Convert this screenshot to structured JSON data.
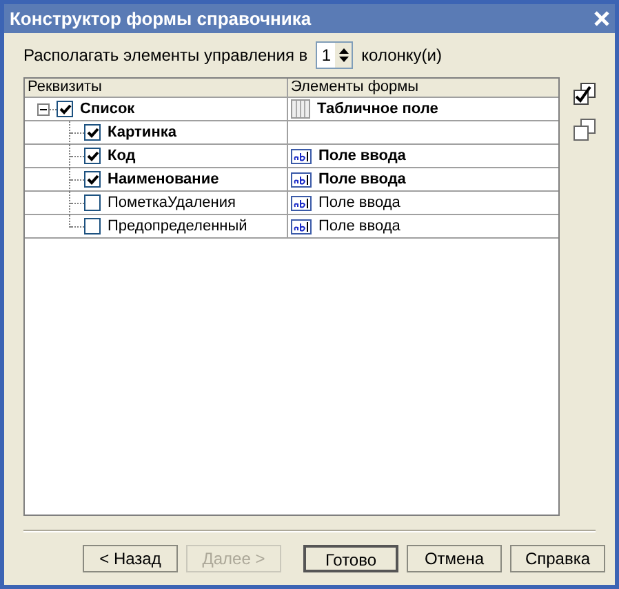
{
  "window": {
    "title": "Конструктор формы справочника"
  },
  "columns_setting": {
    "label": "Располагать элементы управления в",
    "value": "1",
    "suffix": "колонку(и)"
  },
  "table": {
    "columns": [
      "Реквизиты",
      "Элементы формы"
    ],
    "rows": [
      {
        "name": "Список",
        "checked": true,
        "expanded": true,
        "element": {
          "kind": "table",
          "label": "Табличное поле"
        },
        "children": [
          {
            "name": "Картинка",
            "checked": true
          },
          {
            "name": "Код",
            "checked": true,
            "element": {
              "kind": "input",
              "label": "Поле ввода"
            }
          },
          {
            "name": "Наименование",
            "checked": true,
            "element": {
              "kind": "input",
              "label": "Поле ввода"
            }
          },
          {
            "name": "ПометкаУдаления",
            "checked": false,
            "element": {
              "kind": "input",
              "label": "Поле ввода"
            }
          },
          {
            "name": "Предопределенный",
            "checked": false,
            "element": {
              "kind": "input",
              "label": "Поле ввода"
            }
          }
        ]
      }
    ]
  },
  "buttons": [
    {
      "label": "< Назад",
      "disabled": false,
      "default": false
    },
    {
      "label": "Далее >",
      "disabled": true,
      "default": false
    },
    {
      "label": "Готово",
      "disabled": false,
      "default": true
    },
    {
      "label": "Отмена",
      "disabled": false,
      "default": false
    },
    {
      "label": "Справка",
      "disabled": false,
      "default": false
    }
  ]
}
